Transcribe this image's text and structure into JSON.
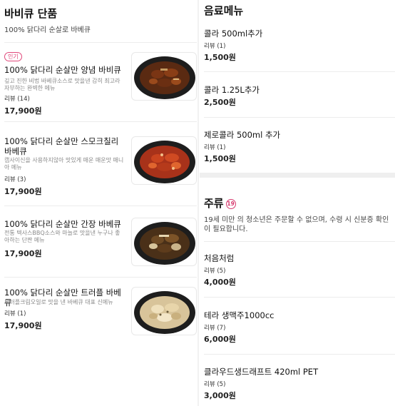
{
  "left": {
    "title": "바비큐 단품",
    "description": "100% 닭다리 순살로 바베큐",
    "items": [
      {
        "badge": "인기",
        "name": "100% 닭다리 순살만 양념 바비큐",
        "description": "깊고 진한 비법 바베큐소스로 맛을낸 감히 최고라 자부하는 완벽한 메뉴",
        "review": "리뷰 (14)",
        "price": "17,900원",
        "image_icon": "bbq-yangnyeom-photo"
      },
      {
        "name": "100% 닭다리 순살만 스모크칠리 바베큐",
        "description": "캡사이신을 사용하지않아 맛있게 매운 매운맛 매니아 메뉴",
        "review": "리뷰 (3)",
        "price": "17,900원",
        "image_icon": "bbq-smoke-chili-photo"
      },
      {
        "name": "100% 닭다리 순살만 간장 바베큐",
        "description": "전통 텍사스BBQ소스와 마늘로 맛을낸 누구나 좋아하는 단짠 메뉴",
        "review": "",
        "price": "17,900원",
        "image_icon": "bbq-soy-photo"
      },
      {
        "name": "100% 닭다리 순살만 트러플 바베큐",
        "description": "트러플크림오일로 맛을 낸 바베큐 대표 신메뉴",
        "review": "리뷰 (1)",
        "price": "17,900원",
        "image_icon": "bbq-truffle-photo"
      }
    ]
  },
  "right": {
    "drinks_title": "음료메뉴",
    "drinks": [
      {
        "name": "콜라 500ml추가",
        "review": "리뷰 (1)",
        "price": "1,500원"
      },
      {
        "name": "콜라 1.25L추가",
        "review": "",
        "price": "2,500원"
      },
      {
        "name": "제로콜라 500ml 추가",
        "review": "리뷰 (1)",
        "price": "1,500원"
      }
    ],
    "liquor_title": "주류",
    "liquor_age_badge": "19",
    "liquor_description": "19세 미만 의 청소년은 주문할 수 없으며, 수령 시 신분증 확인이 필요합니다.",
    "liquor": [
      {
        "name": "처음처럼",
        "review": "리뷰 (5)",
        "price": "4,000원"
      },
      {
        "name": "테라 생맥주1000cc",
        "review": "리뷰 (7)",
        "price": "6,000원"
      },
      {
        "name": "클라우드생드래프트 420ml PET",
        "review": "리뷰 (5)",
        "price": "3,000원"
      }
    ]
  },
  "colors": {
    "accent_pink": "#e0487a",
    "divider": "#ececec",
    "section_band": "#efefef"
  }
}
